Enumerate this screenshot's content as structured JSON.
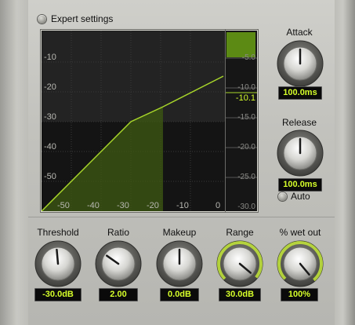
{
  "expert_settings_label": "Expert settings",
  "graph": {
    "x_ticks": [
      "-50",
      "-40",
      "-30",
      "-20",
      "-10",
      "0"
    ],
    "y_ticks": [
      "-10",
      "-20",
      "-30",
      "-40",
      "-50"
    ]
  },
  "meter": {
    "ticks": [
      "-5.0",
      "-10.0",
      "-15.0",
      "-20.0",
      "-25.0",
      "-30.0"
    ],
    "current": "-10.1"
  },
  "attack": {
    "label": "Attack",
    "value": "100.0ms"
  },
  "release": {
    "label": "Release",
    "value": "100.0ms"
  },
  "auto_label": "Auto",
  "threshold": {
    "label": "Threshold",
    "value": "-30.0dB"
  },
  "ratio": {
    "label": "Ratio",
    "value": "2.00"
  },
  "makeup": {
    "label": "Makeup",
    "value": "0.0dB"
  },
  "range": {
    "label": "Range",
    "value": "30.0dB"
  },
  "wet_out": {
    "label": "% wet out",
    "value": "100%"
  },
  "colors": {
    "accent": "#d6ff2a",
    "curve": "#a8d62a",
    "fill": "#3d5a12"
  }
}
